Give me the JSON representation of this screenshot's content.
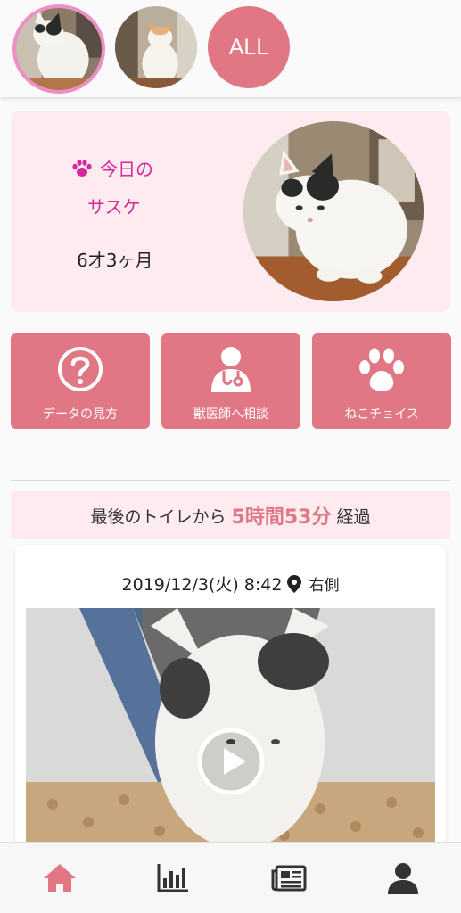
{
  "cat_selector": {
    "all_label": "ALL"
  },
  "profile": {
    "today_label": "今日の",
    "cat_name": "サスケ",
    "age": "6才3ヶ月"
  },
  "actions": [
    {
      "label": "データの見方",
      "icon": "question-circle-icon"
    },
    {
      "label": "獣医師へ相談",
      "icon": "doctor-icon"
    },
    {
      "label": "ねこチョイス",
      "icon": "paw-icon"
    }
  ],
  "elapsed": {
    "prefix": "最後のトイレから",
    "value": "5時間53分",
    "suffix": "経過"
  },
  "record": {
    "datetime": "2019/12/3(火) 8:42",
    "location_icon": "map-pin-icon",
    "side": "右側"
  },
  "bottom_nav": [
    {
      "icon": "home-icon",
      "active": true
    },
    {
      "icon": "bar-chart-icon",
      "active": false
    },
    {
      "icon": "newspaper-icon",
      "active": false
    },
    {
      "icon": "user-icon",
      "active": false
    }
  ],
  "colors": {
    "accent": "#e17784",
    "accent_text": "#d6279c",
    "soft_pink": "#fdebef",
    "selected_ring": "#ee8ec6",
    "nav_active": "#e17784",
    "nav_inactive": "#333333"
  }
}
